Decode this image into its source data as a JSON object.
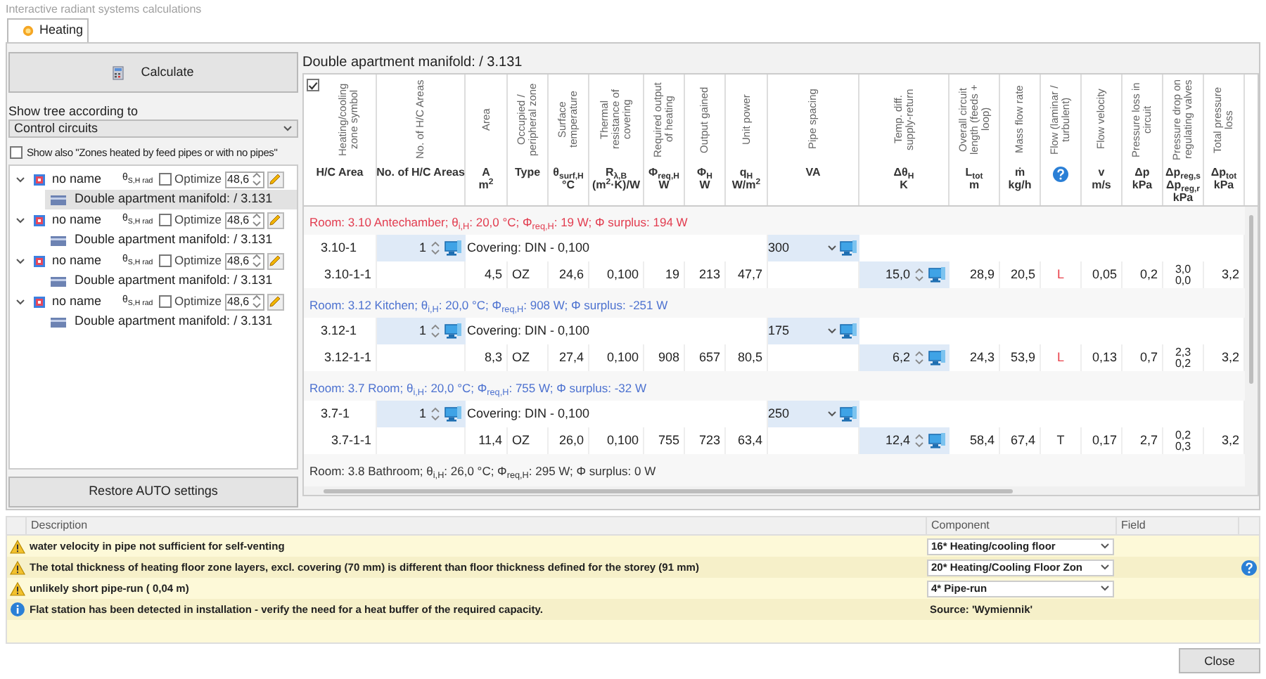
{
  "window": {
    "title": "Interactive radiant systems calculations"
  },
  "tabs": [
    {
      "label": "Heating",
      "selected": true
    }
  ],
  "left_panel": {
    "calculate_button": "Calculate",
    "tree_mode": {
      "label": "Show tree according to",
      "value": "Control circuits"
    },
    "show_also": {
      "label": "Show also \"Zones heated by feed pipes or with no pipes\"",
      "checked": false
    },
    "tree": [
      {
        "name": "no name",
        "expanded": true,
        "temp_label": "θ$_{S,H rad}$",
        "optimize_label": "Optimize",
        "optimize": false,
        "value": "48,6",
        "children": [
          {
            "label": "Double apartment manifold:  / 3.131",
            "selected": true
          }
        ]
      },
      {
        "name": "no name",
        "expanded": true,
        "temp_label": "θ$_{S,H rad}$",
        "optimize_label": "Optimize",
        "optimize": false,
        "value": "48,6",
        "children": [
          {
            "label": "Double apartment manifold:  / 3.131",
            "selected": false
          }
        ]
      },
      {
        "name": "no name",
        "expanded": true,
        "temp_label": "θ$_{S,H rad}$",
        "optimize_label": "Optimize",
        "optimize": false,
        "value": "48,6",
        "children": [
          {
            "label": "Double apartment manifold:  / 3.131",
            "selected": false
          }
        ]
      },
      {
        "name": "no name",
        "expanded": true,
        "temp_label": "θ$_{S,H rad}$",
        "optimize_label": "Optimize",
        "optimize": false,
        "value": "48,6",
        "children": [
          {
            "label": "Double apartment manifold:  / 3.131",
            "selected": false
          }
        ]
      }
    ],
    "restore_button": "Restore AUTO settings"
  },
  "table": {
    "title": "Double apartment manifold:  / 3.131",
    "select_all": true,
    "columns": [
      {
        "kind": "text",
        "description": "Heating/cooling zone symbol",
        "lines": [
          "H/C Area"
        ]
      },
      {
        "kind": "text",
        "description": "No. of H/C Areas",
        "lines": [
          "No. of H/C Areas"
        ]
      },
      {
        "kind": "text",
        "description": "Area",
        "lines": [
          "A",
          "m$^{2}$"
        ]
      },
      {
        "kind": "text",
        "description": "Occupied / peripheral zone",
        "lines": [
          "Type"
        ]
      },
      {
        "kind": "text",
        "description": "Surface temperature",
        "lines": [
          "θ$_{surf,H}$",
          "°C"
        ]
      },
      {
        "kind": "text",
        "description": "Thermal resistance of covering",
        "lines": [
          "R$_{λ,B}$",
          "(m$^{2}$·K)/W"
        ]
      },
      {
        "kind": "text",
        "description": "Required output of heating",
        "lines": [
          "Φ$_{req,H}$",
          "W"
        ]
      },
      {
        "kind": "text",
        "description": "Output gained",
        "lines": [
          "Φ$_{H}$",
          "W"
        ]
      },
      {
        "kind": "text",
        "description": "Unit power",
        "lines": [
          "q$_{H}$",
          "W/m$^{2}$"
        ]
      },
      {
        "kind": "text",
        "description": "Pipe spacing",
        "lines": [
          "VA"
        ]
      },
      {
        "kind": "text",
        "description": "Temp. diff. supply-return",
        "lines": [
          "Δθ$_{H}$",
          "K"
        ]
      },
      {
        "kind": "text",
        "description": "Overall circuit length (feeds + loop)",
        "lines": [
          "L$_{tot}$",
          "m"
        ]
      },
      {
        "kind": "text",
        "description": "Mass flow rate",
        "lines": [
          "ṁ",
          "kg/h"
        ]
      },
      {
        "kind": "help",
        "description": "Flow (laminar / turbulent)"
      },
      {
        "kind": "text",
        "description": "Flow velocity",
        "lines": [
          "v",
          "m/s"
        ]
      },
      {
        "kind": "text",
        "description": "Pressure loss in circuit",
        "lines": [
          "Δp",
          "kPa"
        ]
      },
      {
        "kind": "text",
        "description": "Pressure drop on regulating valves",
        "lines": [
          "Δp$_{reg,s}$",
          "Δp$_{reg,r}$",
          "kPa"
        ]
      },
      {
        "kind": "text",
        "description": "Total pressure loss",
        "lines": [
          "Δp$_{tot}$",
          "kPa"
        ]
      }
    ],
    "rooms": [
      {
        "header": "Room: 3.10 Antechamber; θ$_{i,H}$: 20,0 °C; Φ$_{req,H}$: 19 W; Φ surplus: 194 W",
        "color": "#e23c4f",
        "areas": [
          {
            "symbol": "3.10-1",
            "count": "1",
            "covering": "Covering: DIN - 0,100",
            "pipe_spacing": "300",
            "circuit": {
              "symbol": "3.10-1-1",
              "area": "4,5",
              "type": "OZ",
              "surf_temp": "24,6",
              "resistance": "0,100",
              "req_output": "19",
              "output": "213",
              "unit_power": "47,7",
              "temp_diff": "15,0",
              "length": "28,9",
              "mass_flow": "20,5",
              "flow": {
                "text": "L",
                "color": "#e8404a"
              },
              "velocity": "0,05",
              "pressure_loss": "0,2",
              "reg_drop": [
                "3,0",
                "0,0"
              ],
              "total": "3,2"
            }
          }
        ]
      },
      {
        "header": "Room: 3.12 Kitchen; θ$_{i,H}$: 20,0 °C; Φ$_{req,H}$: 908 W; Φ surplus: -251 W",
        "color": "#4d72d0",
        "areas": [
          {
            "symbol": "3.12-1",
            "count": "1",
            "covering": "Covering: DIN - 0,100",
            "pipe_spacing": "175",
            "circuit": {
              "symbol": "3.12-1-1",
              "area": "8,3",
              "type": "OZ",
              "surf_temp": "27,4",
              "resistance": "0,100",
              "req_output": "908",
              "output": "657",
              "unit_power": "80,5",
              "temp_diff": "6,2",
              "length": "24,3",
              "mass_flow": "53,9",
              "flow": {
                "text": "L",
                "color": "#e8404a"
              },
              "velocity": "0,13",
              "pressure_loss": "0,7",
              "reg_drop": [
                "2,3",
                "0,2"
              ],
              "total": "3,2"
            }
          }
        ]
      },
      {
        "header": "Room: 3.7 Room; θ$_{i,H}$: 20,0 °C; Φ$_{req,H}$: 755 W; Φ surplus: -32 W",
        "color": "#4d72d0",
        "areas": [
          {
            "symbol": "3.7-1",
            "count": "1",
            "covering": "Covering: DIN - 0,100",
            "pipe_spacing": "250",
            "circuit": {
              "symbol": "3.7-1-1",
              "area": "11,4",
              "type": "OZ",
              "surf_temp": "26,0",
              "resistance": "0,100",
              "req_output": "755",
              "output": "723",
              "unit_power": "63,4",
              "temp_diff": "12,4",
              "length": "58,4",
              "mass_flow": "67,4",
              "flow": {
                "text": "T",
                "color": "#333333"
              },
              "velocity": "0,17",
              "pressure_loss": "2,7",
              "reg_drop": [
                "0,2",
                "0,3"
              ],
              "total": "3,2"
            }
          }
        ]
      },
      {
        "header": "Room: 3.8 Bathroom; θ$_{i,H}$: 26,0 °C; Φ$_{req,H}$: 295 W; Φ surplus: 0 W",
        "color": "#333333"
      }
    ]
  },
  "messages": {
    "columns": [
      "Description",
      "Component",
      "Field"
    ],
    "rows": [
      {
        "kind": "warning",
        "text": "water velocity in pipe not sufficient for self-venting",
        "component": {
          "kind": "dropdown",
          "text": "16* Heating/cooling floor"
        },
        "help": false
      },
      {
        "kind": "warning",
        "text": "The total thickness of heating floor zone layers, excl. covering (70 mm) is different than floor thickness defined for the storey (91 mm)",
        "component": {
          "kind": "dropdown",
          "text": "20* Heating/Cooling Floor Zon"
        },
        "help": true
      },
      {
        "kind": "warning",
        "text": "unlikely short pipe-run ( 0,04 m)",
        "component": {
          "kind": "dropdown",
          "text": "4* Pipe-run"
        },
        "help": false
      },
      {
        "kind": "info",
        "text": "Flat station has been detected in installation - verify the need for a heat buffer of the required capacity.",
        "component": {
          "kind": "text",
          "text": "Source: 'Wymiennik'"
        },
        "help": false
      }
    ]
  },
  "close_button": "Close"
}
